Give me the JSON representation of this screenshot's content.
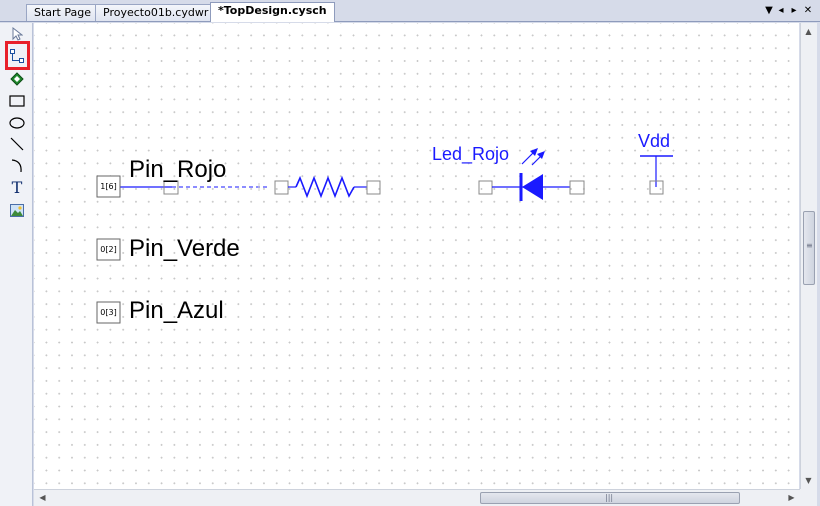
{
  "tabs": [
    {
      "label": "Start Page",
      "active": false
    },
    {
      "label": "Proyecto01b.cydwr",
      "active": false
    },
    {
      "label": "*TopDesign.cysch",
      "active": true
    }
  ],
  "tab_controls": {
    "list": "▼",
    "prev": "◂",
    "next": "▸",
    "close": "✕"
  },
  "tools": [
    {
      "name": "pointer-tool-icon",
      "selected": false
    },
    {
      "name": "wire-tool-icon",
      "selected": true
    },
    {
      "name": "component-tool-icon",
      "selected": false
    },
    {
      "name": "rectangle-tool-icon",
      "selected": false
    },
    {
      "name": "ellipse-tool-icon",
      "selected": false
    },
    {
      "name": "line-tool-icon",
      "selected": false
    },
    {
      "name": "arc-tool-icon",
      "selected": false
    },
    {
      "name": "text-tool-icon",
      "glyph": "T",
      "selected": false
    },
    {
      "name": "image-tool-icon",
      "selected": false
    }
  ],
  "schematic": {
    "wire_color": "#1a1aff",
    "pins": [
      {
        "label": "Pin_Rojo",
        "box": "1[6]"
      },
      {
        "label": "Pin_Verde",
        "box": "0[2]"
      },
      {
        "label": "Pin_Azul",
        "box": "0[3]"
      }
    ],
    "led_label": "Led_Rojo",
    "vdd_label": "Vdd"
  },
  "scroll_arrows": {
    "up": "▲",
    "down": "▼",
    "left": "◀",
    "right": "▶"
  }
}
